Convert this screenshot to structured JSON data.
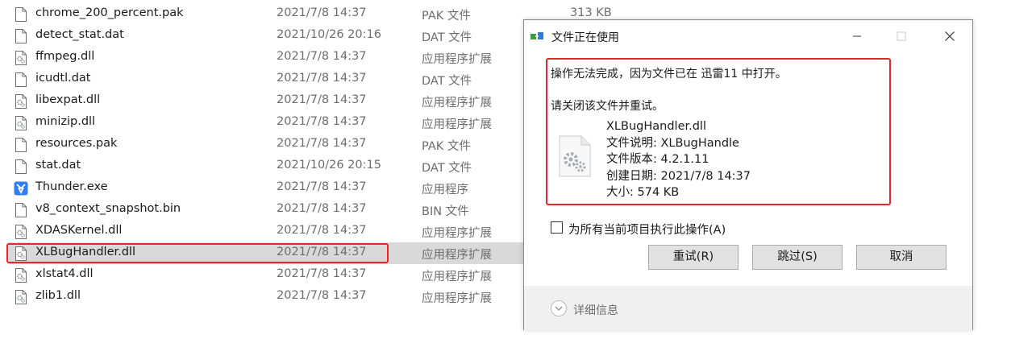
{
  "files": [
    {
      "name": "chrome_200_percent.pak",
      "date": "2021/7/8 14:37",
      "type": "PAK 文件",
      "size": "313 KB",
      "icon": "file-icon"
    },
    {
      "name": "detect_stat.dat",
      "date": "2021/10/26 20:16",
      "type": "DAT 文件",
      "size": "",
      "icon": "file-icon"
    },
    {
      "name": "ffmpeg.dll",
      "date": "2021/7/8 14:37",
      "type": "应用程序扩展",
      "size": "",
      "icon": "dll-icon"
    },
    {
      "name": "icudtl.dat",
      "date": "2021/7/8 14:37",
      "type": "DAT 文件",
      "size": "",
      "icon": "file-icon"
    },
    {
      "name": "libexpat.dll",
      "date": "2021/7/8 14:37",
      "type": "应用程序扩展",
      "size": "",
      "icon": "dll-icon"
    },
    {
      "name": "minizip.dll",
      "date": "2021/7/8 14:37",
      "type": "应用程序扩展",
      "size": "",
      "icon": "dll-icon"
    },
    {
      "name": "resources.pak",
      "date": "2021/7/8 14:37",
      "type": "PAK 文件",
      "size": "",
      "icon": "file-icon"
    },
    {
      "name": "stat.dat",
      "date": "2021/10/26 20:15",
      "type": "DAT 文件",
      "size": "",
      "icon": "file-icon"
    },
    {
      "name": "Thunder.exe",
      "date": "2021/7/8 14:37",
      "type": "应用程序",
      "size": "",
      "icon": "thunder-icon"
    },
    {
      "name": "v8_context_snapshot.bin",
      "date": "2021/7/8 14:37",
      "type": "BIN 文件",
      "size": "",
      "icon": "file-icon"
    },
    {
      "name": "XDASKernel.dll",
      "date": "2021/7/8 14:37",
      "type": "应用程序扩展",
      "size": "",
      "icon": "dll-icon"
    },
    {
      "name": "XLBugHandler.dll",
      "date": "2021/7/8 14:37",
      "type": "应用程序扩展",
      "size": "",
      "icon": "dll-icon",
      "selected": true
    },
    {
      "name": "xlstat4.dll",
      "date": "2021/7/8 14:37",
      "type": "应用程序扩展",
      "size": "",
      "icon": "dll-icon"
    },
    {
      "name": "zlib1.dll",
      "date": "2021/7/8 14:37",
      "type": "应用程序扩展",
      "size": "",
      "icon": "dll-icon"
    }
  ],
  "dialog": {
    "title": "文件正在使用",
    "message_line1": "操作无法完成，因为文件已在 迅雷11 中打开。",
    "message_line2": "请关闭该文件并重试。",
    "file_name": "XLBugHandler.dll",
    "file_description": "文件说明: XLBugHandle",
    "file_version": "文件版本: 4.2.1.11",
    "created": "创建日期: 2021/7/8 14:37",
    "size": "大小: 574 KB",
    "checkbox_label": "为所有当前项目执行此操作(A)",
    "checkbox_checked": false,
    "retry_label": "重试(R)",
    "skip_label": "跳过(S)",
    "cancel_label": "取消",
    "details_label": "详细信息"
  },
  "colors": {
    "highlight_border": "#e5262a",
    "selection_bg": "#d9d9d9",
    "button_bg": "#e1e1e1",
    "footer_bg": "#f0f0f0"
  }
}
